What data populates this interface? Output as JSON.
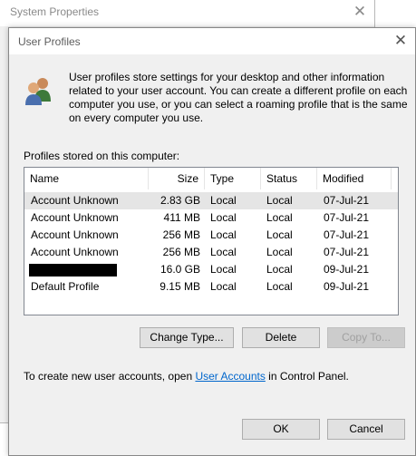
{
  "background_window": {
    "title": "System Properties"
  },
  "dialog": {
    "title": "User Profiles",
    "description": "User profiles store settings for your desktop and other information related to your user account. You can create a different profile on each computer you use, or you can select a roaming profile that is the same on every computer you use.",
    "list_label": "Profiles stored on this computer:",
    "columns": {
      "name": "Name",
      "size": "Size",
      "type": "Type",
      "status": "Status",
      "modified": "Modified"
    },
    "rows": [
      {
        "name": "Account Unknown",
        "size": "2.83 GB",
        "type": "Local",
        "status": "Local",
        "modified": "07-Jul-21"
      },
      {
        "name": "Account Unknown",
        "size": "411 MB",
        "type": "Local",
        "status": "Local",
        "modified": "07-Jul-21"
      },
      {
        "name": "Account Unknown",
        "size": "256 MB",
        "type": "Local",
        "status": "Local",
        "modified": "07-Jul-21"
      },
      {
        "name": "Account Unknown",
        "size": "256 MB",
        "type": "Local",
        "status": "Local",
        "modified": "07-Jul-21"
      },
      {
        "name": "",
        "size": "16.0 GB",
        "type": "Local",
        "status": "Local",
        "modified": "09-Jul-21"
      },
      {
        "name": "Default Profile",
        "size": "9.15 MB",
        "type": "Local",
        "status": "Local",
        "modified": "09-Jul-21"
      }
    ],
    "buttons": {
      "change_type": "Change Type...",
      "delete": "Delete",
      "copy_to": "Copy To..."
    },
    "footer": {
      "prefix": "To create new user accounts, open ",
      "link": "User Accounts",
      "suffix": " in Control Panel."
    },
    "ok": "OK",
    "cancel": "Cancel"
  },
  "icons": {
    "close": "close-icon",
    "users": "users-icon"
  },
  "colors": {
    "link": "#0066cc",
    "selected_row": "#e5e5e5",
    "dialog_bg": "#f0f0f0"
  }
}
